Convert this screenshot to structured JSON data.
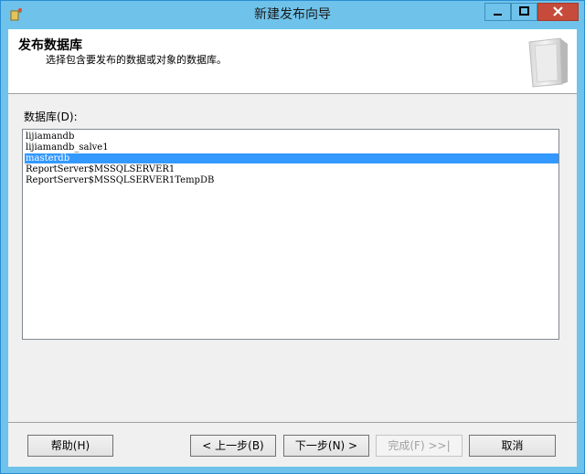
{
  "window": {
    "title": "新建发布向导"
  },
  "header": {
    "title": "发布数据库",
    "subtitle": "选择包含要发布的数据或对象的数据库。"
  },
  "database_label": "数据库(D):",
  "databases": [
    {
      "name": "lijiamandb",
      "selected": false
    },
    {
      "name": "lijiamandb_salve1",
      "selected": false
    },
    {
      "name": "masterdb",
      "selected": true
    },
    {
      "name": "ReportServer$MSSQLSERVER1",
      "selected": false
    },
    {
      "name": "ReportServer$MSSQLSERVER1TempDB",
      "selected": false
    }
  ],
  "buttons": {
    "help": "帮助(H)",
    "back": "< 上一步(B)",
    "next": "下一步(N) >",
    "finish": "完成(F) >>|",
    "cancel": "取消"
  },
  "colors": {
    "titlebar": "#6fc3ea",
    "selection": "#3399ff",
    "close_button": "#c74b3a"
  },
  "icons": [
    "wizard-app-icon",
    "minimize-icon",
    "maximize-icon",
    "close-icon",
    "publication-icon"
  ]
}
